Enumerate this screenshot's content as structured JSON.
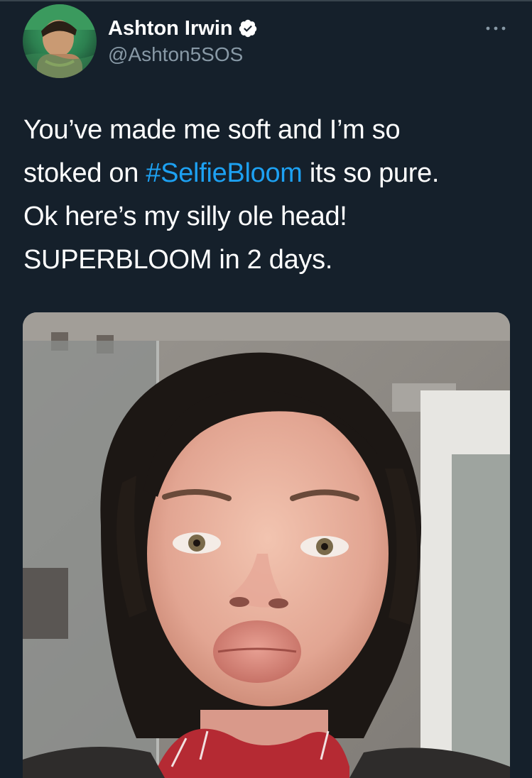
{
  "tweet": {
    "author": {
      "display_name": "Ashton Irwin",
      "handle": "@Ashton5SOS",
      "verified_icon": "verified-badge-icon",
      "avatar_icon": "avatar-photo"
    },
    "more_icon": "more-dots-icon",
    "text": {
      "line1": "You’ve made me soft and I’m so",
      "line2_before": "stoked on ",
      "line2_hashtag": "#SelfieBloom",
      "line2_after": " its so pure.",
      "line3": "Ok here’s my silly ole head!",
      "line4": "SUPERBLOOM in 2 days."
    },
    "media": {
      "type": "photo",
      "subject": "selfie-photo"
    }
  },
  "colors": {
    "background": "#15202b",
    "text": "#ffffff",
    "secondary_text": "#8899a6",
    "link": "#1da1f2",
    "divider": "#38444d"
  }
}
